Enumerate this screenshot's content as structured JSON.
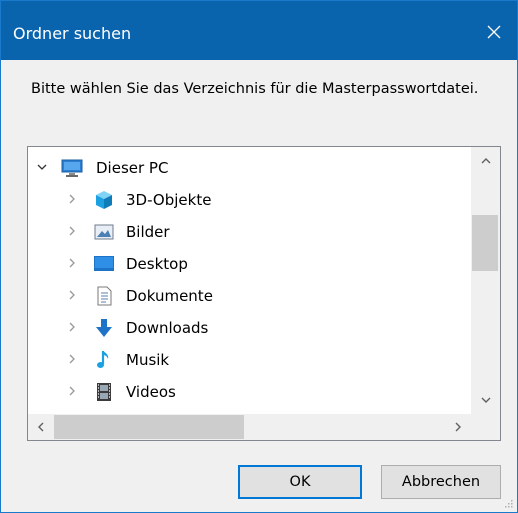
{
  "window": {
    "title": "Ordner suchen",
    "close_icon": "close-icon"
  },
  "prompt": "Bitte wählen Sie das Verzeichnis für die Masterpasswortdatei.",
  "tree": {
    "root": {
      "label": "Dieser PC",
      "icon": "computer-icon",
      "expanded": true
    },
    "items": [
      {
        "label": "3D-Objekte",
        "icon": "3d-objects-icon"
      },
      {
        "label": "Bilder",
        "icon": "pictures-icon"
      },
      {
        "label": "Desktop",
        "icon": "desktop-icon"
      },
      {
        "label": "Dokumente",
        "icon": "documents-icon"
      },
      {
        "label": "Downloads",
        "icon": "downloads-icon"
      },
      {
        "label": "Musik",
        "icon": "music-icon"
      },
      {
        "label": "Videos",
        "icon": "videos-icon"
      }
    ]
  },
  "buttons": {
    "ok": "OK",
    "cancel": "Abbrechen"
  },
  "colors": {
    "titlebar": "#0a64ad",
    "dialog_bg": "#f0f0f0",
    "focus_border": "#0078d7"
  }
}
